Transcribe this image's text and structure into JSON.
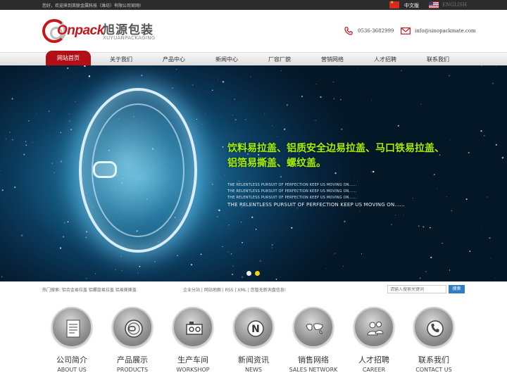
{
  "topbar": {
    "welcome": "您好，欢迎来到英联金属科技（潍坊）有限公司官网!",
    "lang_cn": "中文版",
    "lang_en": "ENGLISH"
  },
  "header": {
    "logo_word": "Onpack",
    "logo_cn": "旭源包装",
    "logo_en": "XUYUANPACKAGING",
    "phone": "0536-3682999",
    "email": "info@sinopackmate.com"
  },
  "nav": {
    "items": [
      {
        "label": "网站首页",
        "active": true
      },
      {
        "label": "关于我们"
      },
      {
        "label": "产品中心"
      },
      {
        "label": "新闻中心"
      },
      {
        "label": "厂容厂貌"
      },
      {
        "label": "营销网络"
      },
      {
        "label": "人才招聘"
      },
      {
        "label": "联系我们"
      }
    ]
  },
  "banner": {
    "headline_1": "饮料易拉盖、铝质安全边易拉盖、马口铁易拉盖、",
    "headline_2": "铝箔易撕盖、螺纹盖。",
    "tagline": "THE RELENTLESS PURSUIT OF PERFECTION KEEP US MOVING ON......",
    "tagline_big": "THE RELENTLESS PURSUIT OF PERFECTION KEEP US MOVING ON......",
    "slides": 2,
    "active_slide": 2
  },
  "infobar": {
    "hot": "热门搜索:  铝合金易拉盖  铝螺旋易拉盖  铝易撕撕盖",
    "links": "企业分站 | 网站地图 | RSS | XML | 您暂无新询盘信息!",
    "search_placeholder": "请输入搜索关键词",
    "search_button": "搜索"
  },
  "features": [
    {
      "cn": "公司简介",
      "en": "ABOUT US",
      "icon": "document-icon"
    },
    {
      "cn": "产品展示",
      "en": "PRODUCTS",
      "icon": "can-lid-icon"
    },
    {
      "cn": "生产车间",
      "en": "WORKSHOP",
      "icon": "workshop-icon"
    },
    {
      "cn": "新闻资讯",
      "en": "NEWS",
      "icon": "news-icon"
    },
    {
      "cn": "销售网络",
      "en": "SALES NETWORK",
      "icon": "world-map-icon"
    },
    {
      "cn": "人才招聘",
      "en": "CAREER",
      "icon": "people-icon"
    },
    {
      "cn": "联系我们",
      "en": "CONTACT US",
      "icon": "telephone-icon"
    }
  ]
}
